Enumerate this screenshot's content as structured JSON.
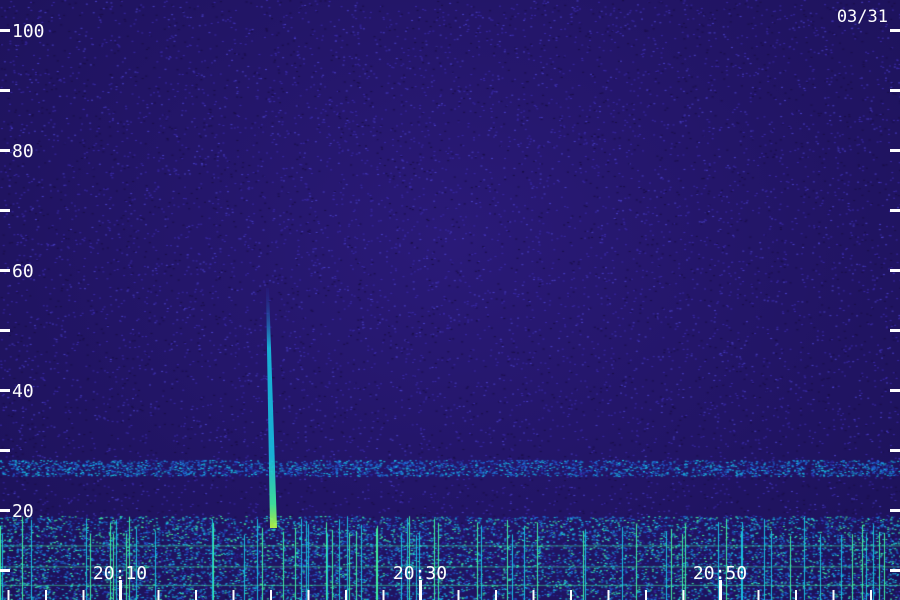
{
  "chart_data": {
    "type": "heatmap",
    "date_label": "03/31",
    "y_ticks": [
      {
        "value": 20,
        "label": "20"
      },
      {
        "value": 40,
        "label": "40"
      },
      {
        "value": 60,
        "label": "60"
      },
      {
        "value": 80,
        "label": "80"
      },
      {
        "value": 100,
        "label": "100"
      }
    ],
    "y_minor_ticks": [
      10,
      30,
      50,
      70,
      90
    ],
    "ylim": [
      5,
      105
    ],
    "x_ticks": [
      {
        "value": 10,
        "label": "20:10"
      },
      {
        "value": 30,
        "label": "20:30"
      },
      {
        "value": 50,
        "label": "20:50"
      }
    ],
    "x_minor_step": 2.5,
    "xlim": [
      2,
      62
    ],
    "colormap": [
      "#1c1258",
      "#2a2aa0",
      "#1e6cd8",
      "#18c0e0",
      "#40f0a0",
      "#c0ff40"
    ],
    "features": {
      "burst": {
        "x": 19.8,
        "y_top": 57,
        "y_bottom": 17
      },
      "interference_band": {
        "y": 27
      },
      "low_band": {
        "y_top": 19,
        "y_bottom": 5
      }
    }
  }
}
